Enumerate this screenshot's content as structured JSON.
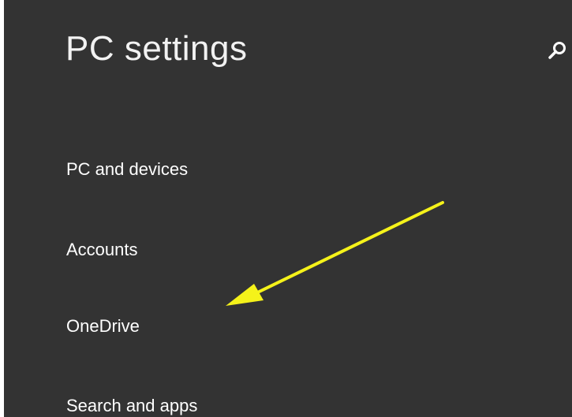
{
  "header": {
    "title": "PC settings",
    "search_icon": "search-icon"
  },
  "nav": {
    "items": [
      {
        "label": "PC and devices"
      },
      {
        "label": "Accounts"
      },
      {
        "label": "OneDrive"
      },
      {
        "label": "Search and apps"
      }
    ]
  },
  "annotation": {
    "arrow_color": "#f5f21a",
    "points_to": "OneDrive"
  },
  "colors": {
    "background": "#333333",
    "text": "#ffffff"
  }
}
